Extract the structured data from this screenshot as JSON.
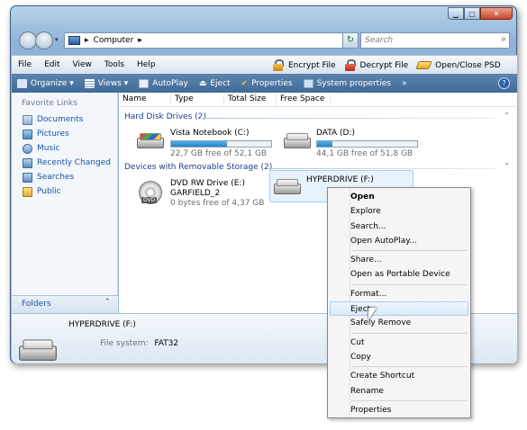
{
  "window": {
    "caption_buttons": [
      "minimize",
      "maximize",
      "close"
    ]
  },
  "nav": {
    "address": "Computer",
    "search_placeholder": "Search"
  },
  "menu": {
    "items": [
      "File",
      "Edit",
      "View",
      "Tools",
      "Help"
    ],
    "encrypt": "Encrypt File",
    "decrypt": "Decrypt File",
    "openclose": "Open/Close PSD"
  },
  "toolbar": {
    "organize": "Organize",
    "views": "Views",
    "autoplay": "AutoPlay",
    "eject": "Eject",
    "properties": "Properties",
    "system_properties": "System properties",
    "more": "»",
    "help": "?"
  },
  "sidebar": {
    "header": "Favorite Links",
    "links": [
      "Documents",
      "Pictures",
      "Music",
      "Recently Changed",
      "Searches",
      "Public"
    ],
    "folders": "Folders"
  },
  "columns": [
    "Name",
    "Type",
    "Total Size",
    "Free Space"
  ],
  "groups": {
    "hdd": "Hard Disk Drives (2)",
    "removable": "Devices with Removable Storage (2)"
  },
  "drives": {
    "c": {
      "name": "Vista Notebook (C:)",
      "free": "22,7 GB free of 52,1 GB",
      "used_fraction": 0.56
    },
    "d": {
      "name": "DATA (D:)",
      "free": "44,1 GB free of 51,8 GB",
      "used_fraction": 0.15
    },
    "e": {
      "name": "DVD RW Drive (E:)",
      "label": "GARFIELD_2",
      "free": "0 bytes free of 4,37 GB"
    },
    "f": {
      "name": "HYPERDRIVE (F:)"
    }
  },
  "details": {
    "name": "HYPERDRIVE (F:)",
    "fs_label": "File system:",
    "fs_value": "FAT32"
  },
  "context_menu": [
    {
      "label": "Open",
      "bold": true
    },
    {
      "label": "Explore"
    },
    {
      "label": "Search..."
    },
    {
      "label": "Open AutoPlay..."
    },
    {
      "sep": true
    },
    {
      "label": "Share..."
    },
    {
      "label": "Open as Portable Device"
    },
    {
      "sep": true
    },
    {
      "label": "Format..."
    },
    {
      "label": "Eject",
      "highlight": true
    },
    {
      "label": "Safely Remove"
    },
    {
      "sep": true
    },
    {
      "label": "Cut"
    },
    {
      "label": "Copy"
    },
    {
      "sep": true
    },
    {
      "label": "Create Shortcut"
    },
    {
      "label": "Rename"
    },
    {
      "sep": true
    },
    {
      "label": "Properties"
    }
  ],
  "colors": {
    "toolbar": "#4a76a3",
    "link": "#1a54a8",
    "bar_fill": "#2b8fd0"
  }
}
